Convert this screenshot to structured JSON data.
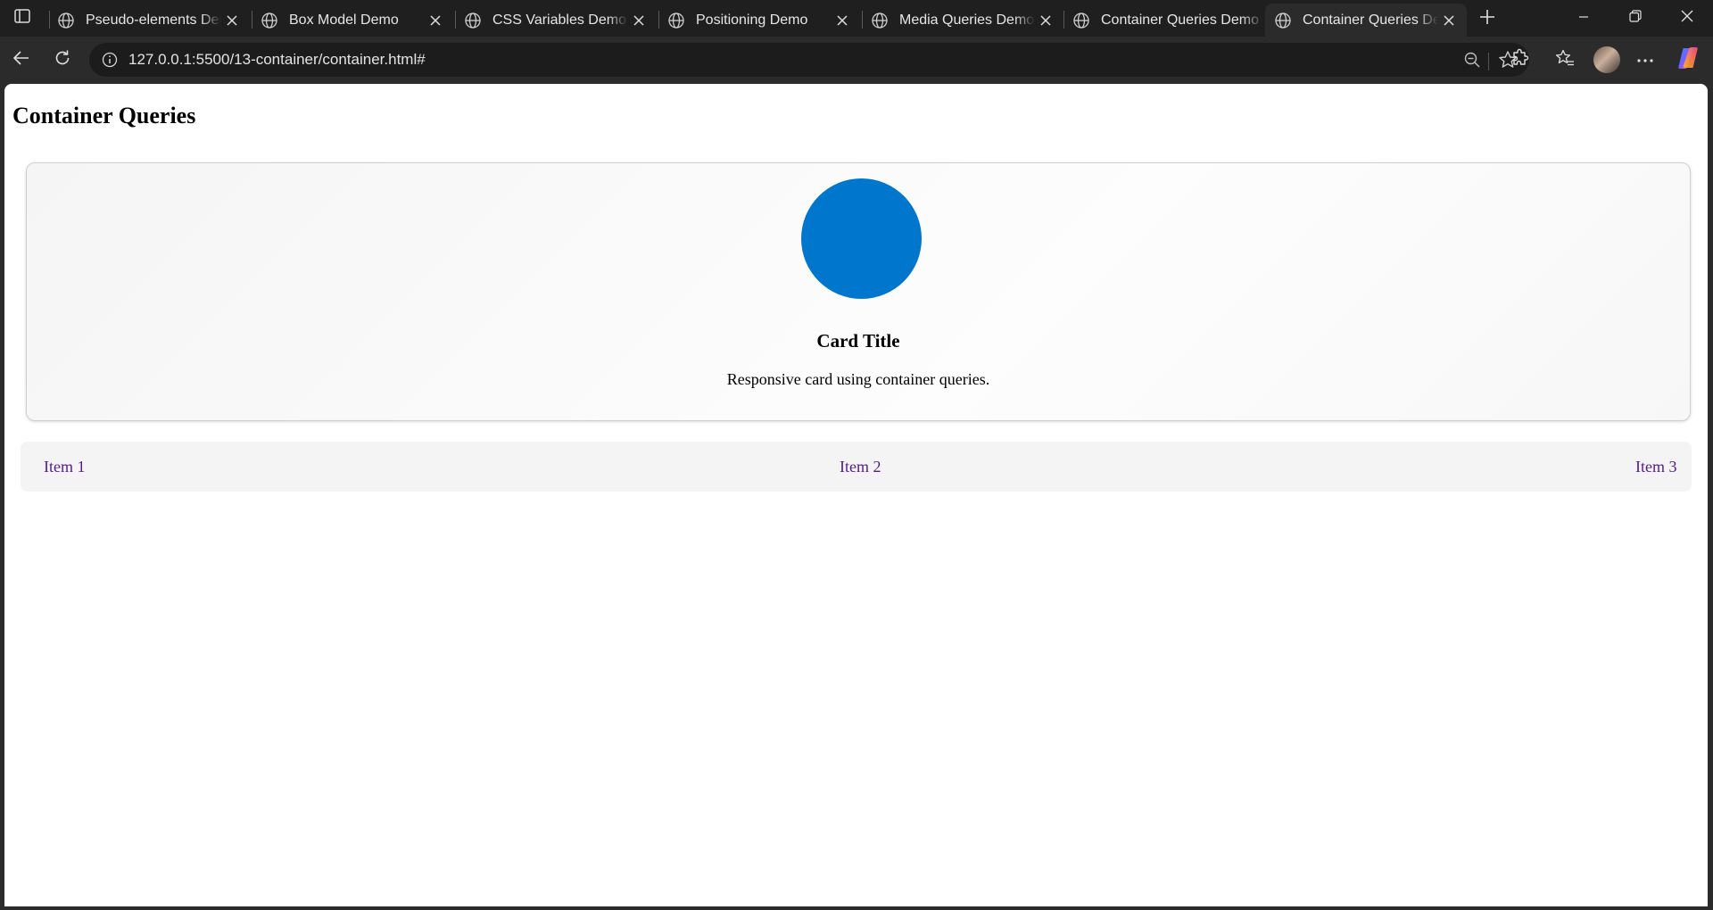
{
  "tabs": [
    {
      "title": "Pseudo-elements Demo",
      "active": false
    },
    {
      "title": "Box Model Demo",
      "active": false
    },
    {
      "title": "CSS Variables Demo",
      "active": false
    },
    {
      "title": "Positioning Demo",
      "active": false
    },
    {
      "title": "Media Queries Demo",
      "active": false
    },
    {
      "title": "Container Queries Demo",
      "active": false
    },
    {
      "title": "Container Queries Demo",
      "active": true
    }
  ],
  "address": {
    "url": "127.0.0.1:5500/13-container/container.html#"
  },
  "page": {
    "title": "Container Queries",
    "card": {
      "title": "Card Title",
      "text": "Responsive card using container queries.",
      "circle_color": "#0077cc"
    },
    "nav_items": [
      "Item 1",
      "Item 2",
      "Item 3"
    ]
  },
  "colors": {
    "link_visited": "#551a8b",
    "tab_strip": "#1f1f1f",
    "toolbar": "#2b2b2b"
  },
  "icons": [
    "sidebar-icon",
    "globe-icon",
    "close-icon",
    "plus-icon",
    "minimize-icon",
    "restore-icon",
    "back-icon",
    "refresh-icon",
    "info-icon",
    "zoom-out-icon",
    "star-icon",
    "extensions-icon",
    "favorites-icon",
    "more-icon",
    "copilot-icon"
  ]
}
